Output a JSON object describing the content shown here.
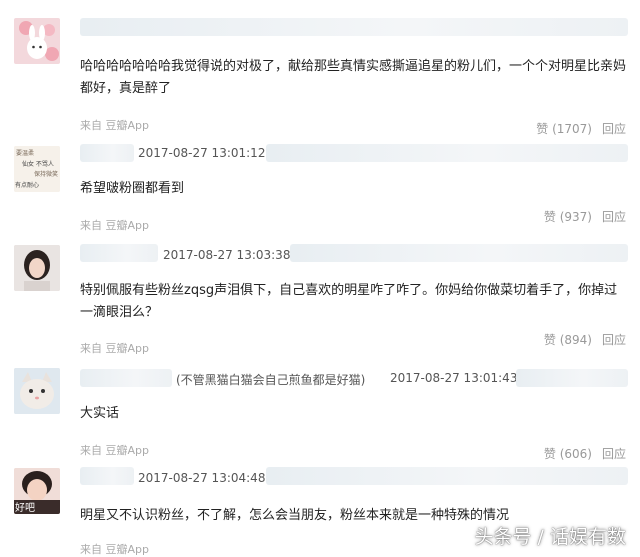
{
  "comments": [
    {
      "time": "",
      "note": "",
      "text": "哈哈哈哈哈哈哈我觉得说的对极了，献给那些真情实感撕逼追星的粉儿们，一个个对明星比亲妈都好，真是醉了",
      "source": "来自 豆瓣App",
      "likes": "赞 (1707)",
      "reply": "回应",
      "avatar_icon": "cartoon-bunny-icon"
    },
    {
      "time": "2017-08-27 13:01:12",
      "note": "",
      "text": "希望啵粉圈都看到",
      "source": "来自 豆瓣App",
      "likes": "赞 (937)",
      "reply": "回应",
      "avatar_icon": "text-card-icon",
      "avatar_text": [
        "要温柔",
        "仙女 不骂人",
        "保持微笑",
        "有点耐心"
      ]
    },
    {
      "time": "2017-08-27 13:03:38",
      "note": "",
      "text": "特别佩服有些粉丝zqsg声泪俱下，自己喜欢的明星咋了咋了。你妈给你做菜切着手了，你掉过一滴眼泪么？",
      "source": "来自 豆瓣App",
      "likes": "赞 (894)",
      "reply": "回应",
      "avatar_icon": "girl-portrait-icon"
    },
    {
      "time": "2017-08-27 13:01:43",
      "note": "(不管黑猫白猫会自己煎鱼都是好猫)",
      "text": "大实话",
      "source": "来自 豆瓣App",
      "likes": "赞 (606)",
      "reply": "回应",
      "avatar_icon": "cat-face-icon"
    },
    {
      "time": "2017-08-27 13:04:48",
      "note": "",
      "text": "明星又不认识粉丝，不了解，怎么会当朋友，粉丝本来就是一种特殊的情况",
      "source": "来自 豆瓣App",
      "likes": "",
      "reply": "",
      "avatar_icon": "child-photo-icon",
      "avatar_text": [
        "好吧"
      ]
    }
  ],
  "watermark": "头条号 / 话娱有数"
}
